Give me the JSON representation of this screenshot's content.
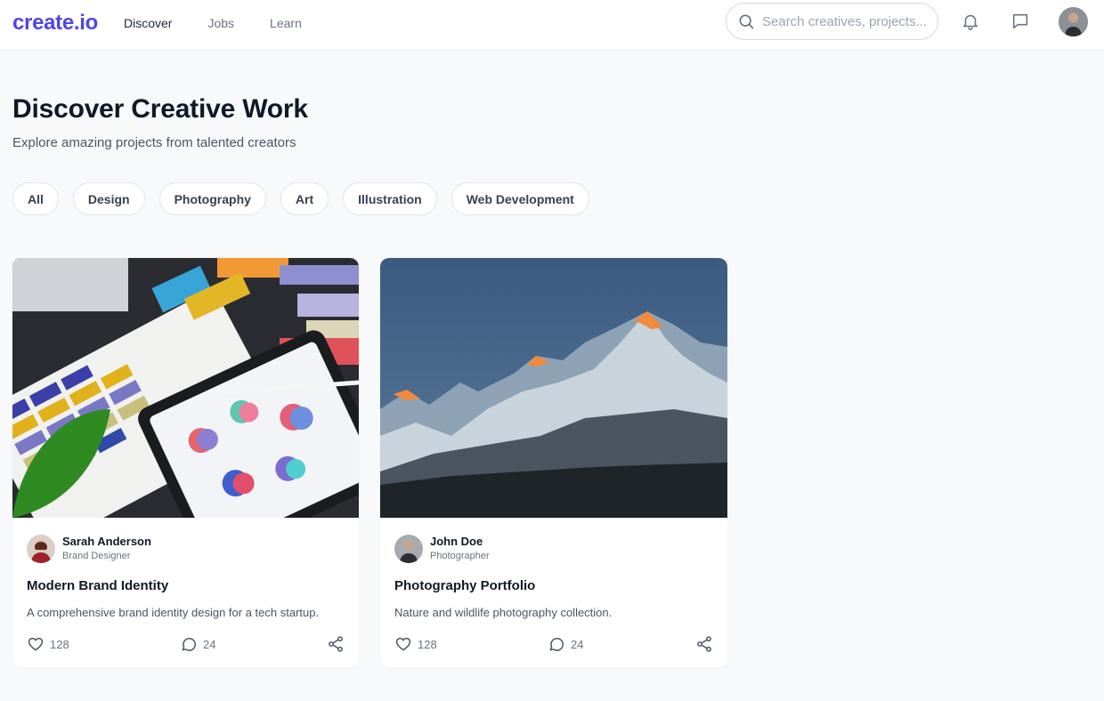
{
  "header": {
    "logo": "create.io",
    "nav": [
      {
        "label": "Discover",
        "active": true
      },
      {
        "label": "Jobs",
        "active": false
      },
      {
        "label": "Learn",
        "active": false
      }
    ],
    "search_placeholder": "Search creatives, projects...",
    "icons": [
      "search-icon",
      "bell-icon",
      "message-icon"
    ]
  },
  "hero": {
    "title": "Discover Creative Work",
    "subtitle": "Explore amazing projects from talented creators"
  },
  "filters": [
    "All",
    "Design",
    "Photography",
    "Art",
    "Illustration",
    "Web Development"
  ],
  "projects": [
    {
      "author": "Sarah Anderson",
      "role": "Brand Designer",
      "title": "Modern Brand Identity",
      "description": "A comprehensive brand identity design for a tech startup.",
      "likes": "128",
      "comments": "24"
    },
    {
      "author": "John Doe",
      "role": "Photographer",
      "title": "Photography Portfolio",
      "description": "Nature and wildlife photography collection.",
      "likes": "128",
      "comments": "24"
    }
  ],
  "colors": {
    "brand": "#4f46e5",
    "background": "#f8f9fb",
    "text": "#111827",
    "muted": "#6b7280"
  }
}
